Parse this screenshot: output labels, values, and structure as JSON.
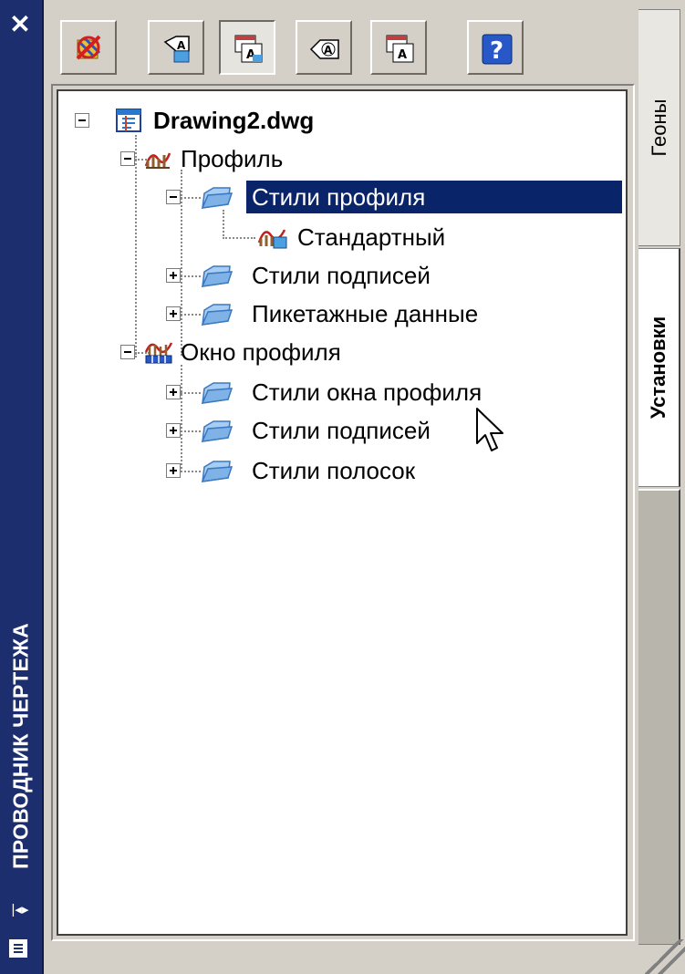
{
  "palette": {
    "title": "ПРОВОДНИК ЧЕРТЕЖА",
    "close_icon": "close-icon",
    "autohide_icon": "autohide-icon",
    "properties_icon": "properties-icon"
  },
  "toolbar": {
    "buttons": [
      {
        "name": "styles-no-filter-button",
        "icon": "no-filter-icon"
      },
      {
        "name": "new-style-button",
        "icon": "new-style-icon"
      },
      {
        "name": "copy-style-button",
        "icon": "copy-style-icon",
        "pressed": true
      },
      {
        "name": "edit-style-button",
        "icon": "edit-style-icon"
      },
      {
        "name": "style-properties-button",
        "icon": "style-properties-icon"
      },
      {
        "name": "help-button",
        "icon": "help-icon",
        "label": "?"
      }
    ]
  },
  "tree": {
    "root": {
      "label": "Drawing2.dwg",
      "expanded": true
    },
    "profile": {
      "label": "Профиль",
      "expanded": true
    },
    "profile_styles": {
      "label": "Стили профиля",
      "expanded": true,
      "selected": true
    },
    "profile_standard": {
      "label": "Стандартный"
    },
    "profile_label_styles": {
      "label": "Стили подписей",
      "expanded": false
    },
    "profile_station_data": {
      "label": "Пикетажные данные",
      "expanded": false
    },
    "profile_view": {
      "label": "Окно профиля",
      "expanded": true
    },
    "profile_view_styles": {
      "label": "Стили окна профиля",
      "expanded": false
    },
    "profile_view_label_styles": {
      "label": "Стили подписей",
      "expanded": false
    },
    "band_styles": {
      "label": "Стили полосок",
      "expanded": false
    }
  },
  "tabs": [
    {
      "label": "Геоны",
      "active": false
    },
    {
      "label": "Установки",
      "active": true
    }
  ],
  "colors": {
    "title_bar": "#1c2e6e",
    "selection": "#0a246a",
    "folder": "#7fb2e6"
  }
}
